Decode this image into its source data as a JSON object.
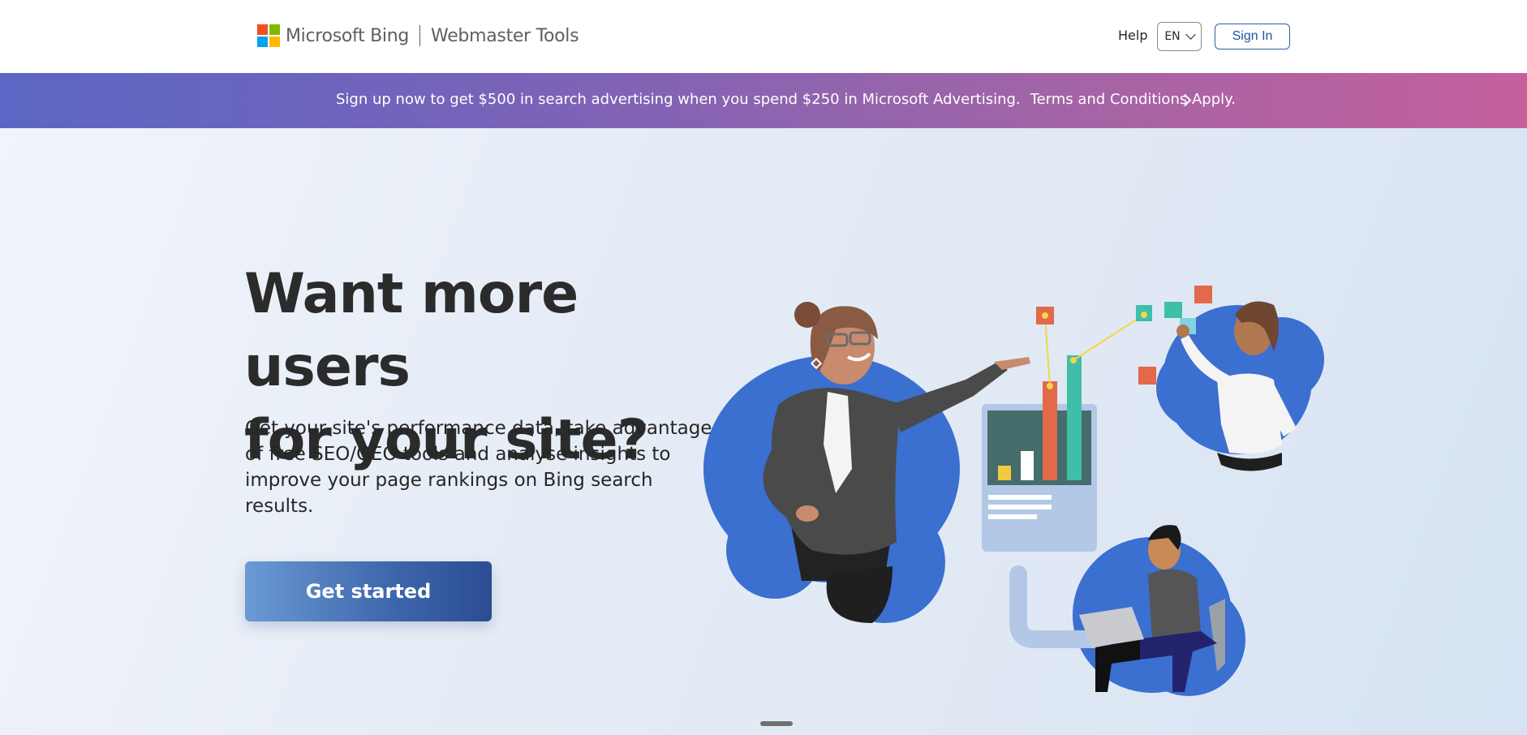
{
  "header": {
    "brand_name": "Microsoft Bing",
    "product_name": "Webmaster Tools",
    "help_label": "Help",
    "language": "EN",
    "sign_in_label": "Sign In",
    "logo_colors": [
      "#f25022",
      "#7fba00",
      "#00a4ef",
      "#ffb900"
    ]
  },
  "banner": {
    "text": "Sign up now to get $500 in search advertising when you spend $250 in Microsoft Advertising.",
    "link_text": "Terms and Conditions Apply."
  },
  "hero": {
    "title_line1": "Want more users",
    "title_line2": "for your site?",
    "description": "Get your site's performance data, take advantage of free SEO/GEO tools and analyse insights to improve your page rankings on Bing search results.",
    "cta_label": "Get started"
  },
  "colors": {
    "accent_blue": "#3a6fd0",
    "link_blue": "#1f57a4",
    "chart_orange": "#e2694a",
    "chart_teal": "#3fbfa8"
  }
}
